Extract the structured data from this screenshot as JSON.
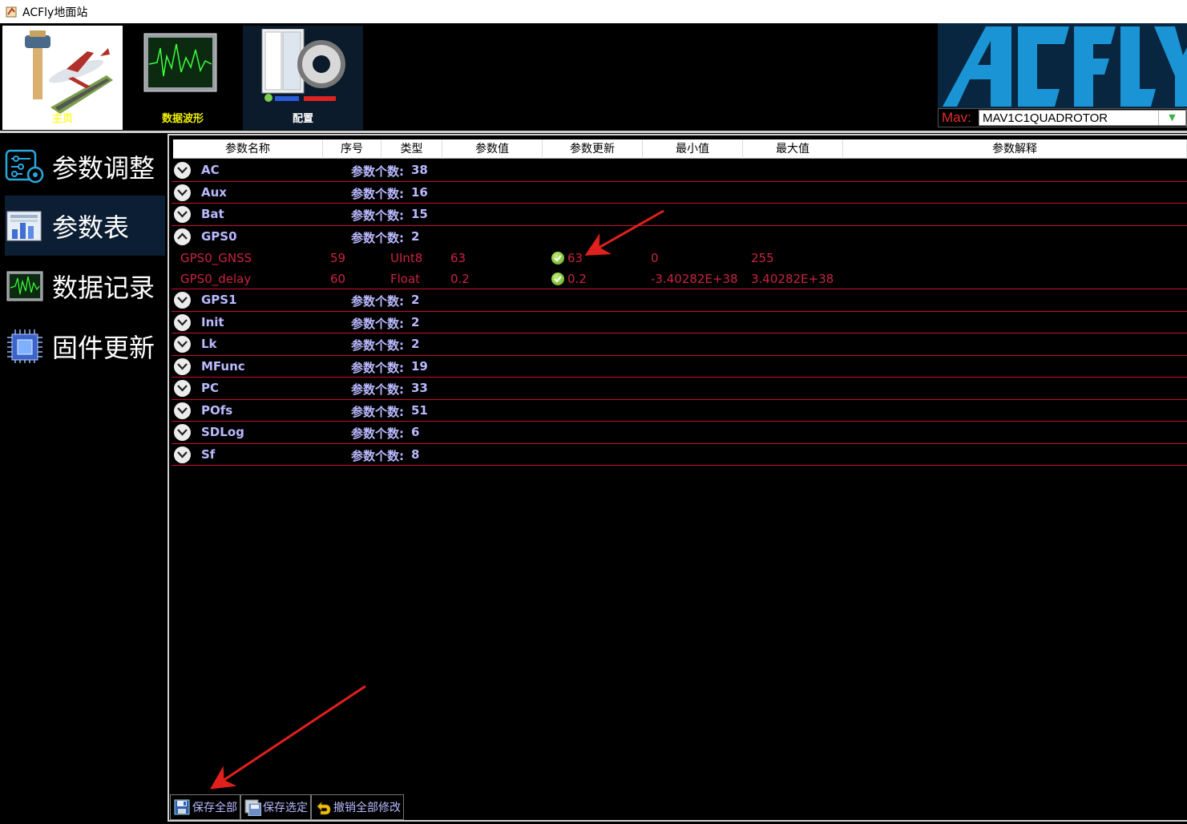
{
  "window": {
    "title": "ACFly地面站"
  },
  "toolbar": {
    "home_label": "主页",
    "wave_label": "数据波形",
    "config_label": "配置"
  },
  "logo": {
    "text": "ACFLY"
  },
  "mav": {
    "label": "Mav:",
    "value": "MAV1C1QUADROTOR"
  },
  "sidebar": {
    "items": [
      {
        "label": "参数调整",
        "icon": "sliders-gear-icon"
      },
      {
        "label": "参数表",
        "icon": "bar-chart-icon",
        "selected": true
      },
      {
        "label": "数据记录",
        "icon": "waveform-monitor-icon"
      },
      {
        "label": "固件更新",
        "icon": "chip-icon"
      }
    ]
  },
  "table": {
    "headers": [
      "参数名称",
      "序号",
      "类型",
      "参数值",
      "参数更新",
      "最小值",
      "最大值",
      "参数解释"
    ],
    "count_label": "参数个数:",
    "groups": [
      {
        "name": "AC",
        "count": "38",
        "expanded": false
      },
      {
        "name": "Aux",
        "count": "16",
        "expanded": false
      },
      {
        "name": "Bat",
        "count": "15",
        "expanded": false
      },
      {
        "name": "GPS0",
        "count": "2",
        "expanded": true,
        "params": [
          {
            "name": "GPS0_GNSS",
            "index": "59",
            "type": "UInt8",
            "value": "63",
            "update": "63",
            "min": "0",
            "max": "255"
          },
          {
            "name": "GPS0_delay",
            "index": "60",
            "type": "Float",
            "value": "0.2",
            "update": "0.2",
            "min": "-3.40282E+38",
            "max": "3.40282E+38"
          }
        ]
      },
      {
        "name": "GPS1",
        "count": "2",
        "expanded": false
      },
      {
        "name": "Init",
        "count": "2",
        "expanded": false
      },
      {
        "name": "Lk",
        "count": "2",
        "expanded": false
      },
      {
        "name": "MFunc",
        "count": "19",
        "expanded": false
      },
      {
        "name": "PC",
        "count": "33",
        "expanded": false
      },
      {
        "name": "POfs",
        "count": "51",
        "expanded": false
      },
      {
        "name": "SDLog",
        "count": "6",
        "expanded": false
      },
      {
        "name": "Sf",
        "count": "8",
        "expanded": false
      }
    ]
  },
  "bottom": {
    "save_all": "保存全部",
    "save_selected": "保存选定",
    "undo_all": "撤销全部修改"
  },
  "colors": {
    "accent_blue": "#1b94d6",
    "group_text": "#b9b9ff",
    "param_text": "#c9243f",
    "row_line": "#c8102e",
    "toolbar_label": "#f2f200"
  }
}
